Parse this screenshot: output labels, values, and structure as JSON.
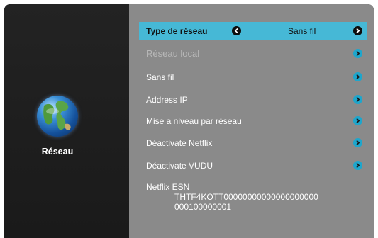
{
  "sidebar": {
    "title": "Réseau",
    "icon": "globe-icon"
  },
  "menu": {
    "network_type": {
      "label": "Type de réseau",
      "value": "Sans fil"
    },
    "items": [
      {
        "label": "Réseau local",
        "enabled": false
      },
      {
        "label": "Sans fil",
        "enabled": true
      },
      {
        "label": "Address  IP",
        "enabled": true
      },
      {
        "label": "Mise a niveau par réseau",
        "enabled": true
      },
      {
        "label": "Déactivate Netflix",
        "enabled": true
      },
      {
        "label": "Déactivate VUDU",
        "enabled": true
      }
    ],
    "netflix_esn": {
      "label": "Netflix ESN",
      "line1": "THTF4KOTT00000000000000000000",
      "line2": "000100000001"
    }
  },
  "colors": {
    "highlight": "#46b8d6",
    "arrow": "#1ea6cc",
    "panel": "#8a8a8a",
    "background": "#1d1d1d"
  }
}
